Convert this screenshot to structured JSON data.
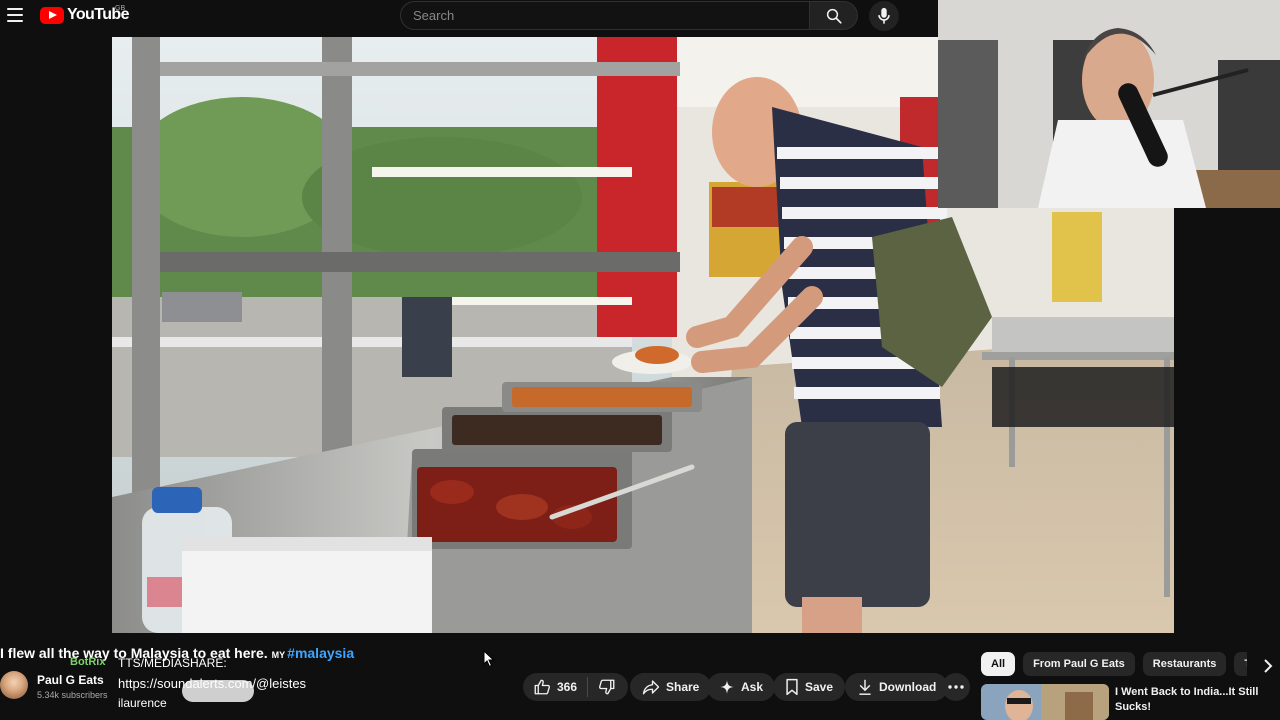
{
  "header": {
    "logo_text": "YouTube",
    "region": "GB",
    "search_placeholder": "Search",
    "icons": [
      "menu-icon",
      "search-icon",
      "microphone-icon"
    ]
  },
  "video": {
    "title_main": "I flew all the way to Malaysia to eat here.",
    "title_flag": "MY",
    "title_hashtag": "#malaysia"
  },
  "channel": {
    "name": "Paul G Eats",
    "subscribers": "5.34k subscribers"
  },
  "stream_overlay": {
    "chat_user": "BotRix",
    "line1": "TTS/MEDIASHARE:",
    "line2": "https://soundalerts.com/@leistes",
    "line3": "ilaurence"
  },
  "actions": {
    "like_count": "366",
    "share_label": "Share",
    "ask_label": "Ask",
    "save_label": "Save",
    "download_label": "Download"
  },
  "chips": [
    "All",
    "From Paul G Eats",
    "Restaurants",
    "Touris"
  ],
  "recommended": {
    "title": "I Went Back to India...It Still Sucks!"
  }
}
